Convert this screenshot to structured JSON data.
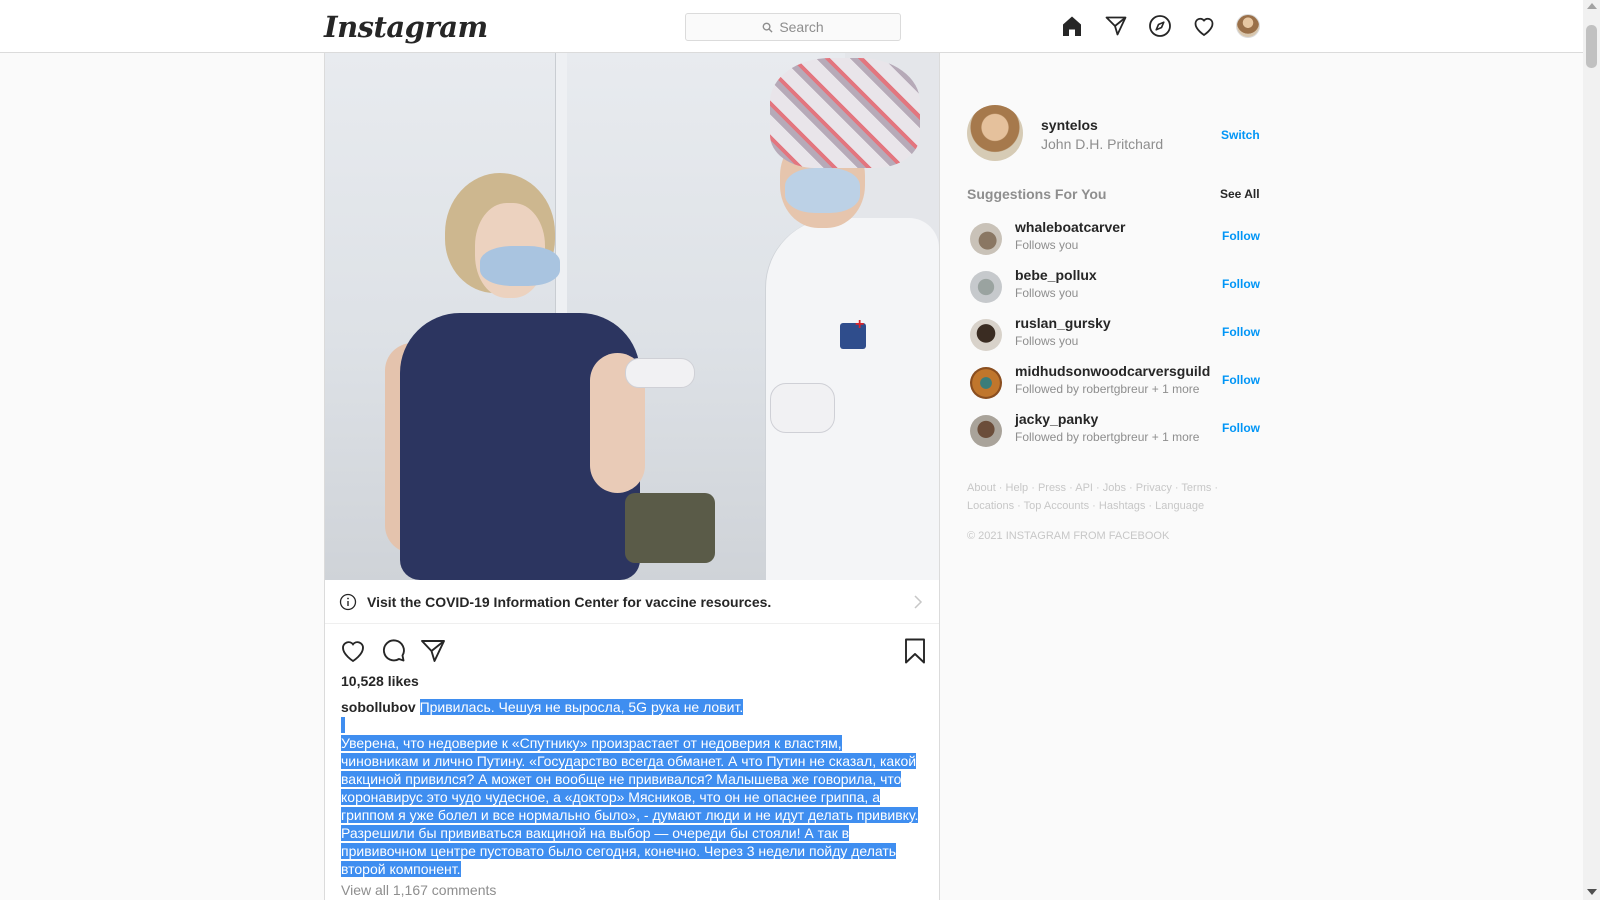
{
  "app": {
    "logo_text": "Instagram"
  },
  "search": {
    "placeholder": "Search"
  },
  "nav": {
    "icons": [
      "home-icon",
      "direct-icon",
      "explore-icon",
      "activity-icon",
      "profile-avatar"
    ]
  },
  "post": {
    "covid_banner": "Visit the COVID-19 Information Center for vaccine resources.",
    "likes": "10,528 likes",
    "author": "sobollubov",
    "caption_first": "Привилась. Чешуя не выросла, 5G рука не ловит.",
    "caption_lines": [
      "Уверена, что недоверие к «Спутнику» произрастает от недоверия к властям,",
      "чиновникам и лично Путину. «Государство всегда обманет. А что Путин не сказал, какой",
      "вакциной привился? А может он вообще не прививался? Малышева же говорила, что",
      "коронавирус это чудо чудесное, а «доктор» Мясников, что он не опаснее гриппа, а",
      "гриппом я уже болел и все нормально было», - думают люди и не идут делать прививку.",
      "Разрешили бы прививаться вакциной на выбор — очереди бы стояли! А так в",
      "прививочном центре пустовато было сегодня, конечно. Через 3 недели пойду делать",
      "второй компонент."
    ],
    "view_all_comments": "View all 1,167 comments",
    "selection_color": "#3f8ef0"
  },
  "sidebar": {
    "me": {
      "username": "syntelos",
      "full_name": "John D.H. Pritchard",
      "switch_label": "Switch"
    },
    "suggestions_title": "Suggestions For You",
    "see_all": "See All",
    "suggestions": [
      {
        "username": "whaleboatcarver",
        "sub": "Follows you",
        "action": "Follow"
      },
      {
        "username": "bebe_pollux",
        "sub": "Follows you",
        "action": "Follow"
      },
      {
        "username": "ruslan_gursky",
        "sub": "Follows you",
        "action": "Follow"
      },
      {
        "username": "midhudsonwoodcarversguild",
        "sub": "Followed by robertgbreur + 1 more",
        "action": "Follow"
      },
      {
        "username": "jacky_panky",
        "sub": "Followed by robertgbreur + 1 more",
        "action": "Follow"
      }
    ],
    "footer_links_row1": [
      "About",
      "Help",
      "Press",
      "API",
      "Jobs",
      "Privacy",
      "Terms"
    ],
    "footer_links_row2": [
      "Locations",
      "Top Accounts",
      "Hashtags",
      "Language"
    ],
    "copyright": "© 2021 INSTAGRAM FROM FACEBOOK"
  },
  "colors": {
    "link_blue": "#0095f6",
    "muted": "#8e8e8e",
    "border": "#dbdbdb"
  }
}
